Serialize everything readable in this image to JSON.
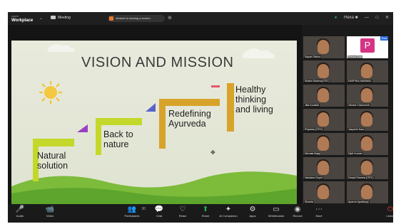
{
  "titlebar": {
    "brand_small": "zoom",
    "brand": "Workplace",
    "meeting_label": "Meeting",
    "share_text": "Ishawer is sharing a screen",
    "controls": [
      "Hexa ■",
      "—",
      "□",
      "✕"
    ]
  },
  "slide": {
    "title": "VISION AND MISSION",
    "steps": [
      {
        "label": "Natural\nsolution",
        "color": "#c3d82a"
      },
      {
        "label": "Back to\nnature",
        "color": "#c3d82a"
      },
      {
        "label": "Redefining\nAyurveda",
        "color": "#d8a32a"
      },
      {
        "label": "Healthy\nthinking\nand living",
        "color": "#d8a32a"
      }
    ],
    "accents": [
      "#9b3fc4",
      "#5a62c9",
      "#e8566c"
    ]
  },
  "gallery": {
    "participants": [
      "Sayani Sahoo",
      "Prerna Gola",
      "Shalini Sharma(ITEC)",
      "DEEPIKA NAINWAL",
      "Jilla Koushik",
      "Vikrant Chaturvedi",
      "Priyanka (ITEC)",
      "Jaspreet Kaur",
      "Nirmala Bajaj",
      "Dipti Kumari",
      "Vandana Goyal",
      "Deepti Sharma (ITEC)",
      "Shweta",
      "Aparna Upadhyay"
    ],
    "pinned_letter": "P",
    "pinned_tag": "Host"
  },
  "toolbar": {
    "buttons": [
      {
        "label": "Audio",
        "icon": "🎤"
      },
      {
        "label": "Video",
        "icon": "📹"
      },
      {
        "label": "Participants",
        "icon": "👥"
      },
      {
        "label": "Chat",
        "icon": "💬"
      },
      {
        "label": "React",
        "icon": "♡"
      },
      {
        "label": "Share",
        "icon": "⬆"
      },
      {
        "label": "AI Companion",
        "icon": "✦"
      },
      {
        "label": "Apps",
        "icon": "⚙"
      },
      {
        "label": "Whiteboards",
        "icon": "▭"
      },
      {
        "label": "Record",
        "icon": "◉"
      },
      {
        "label": "More",
        "icon": "⋯"
      },
      {
        "label": "Leave",
        "icon": "⏻"
      }
    ],
    "participant_count": "30"
  }
}
